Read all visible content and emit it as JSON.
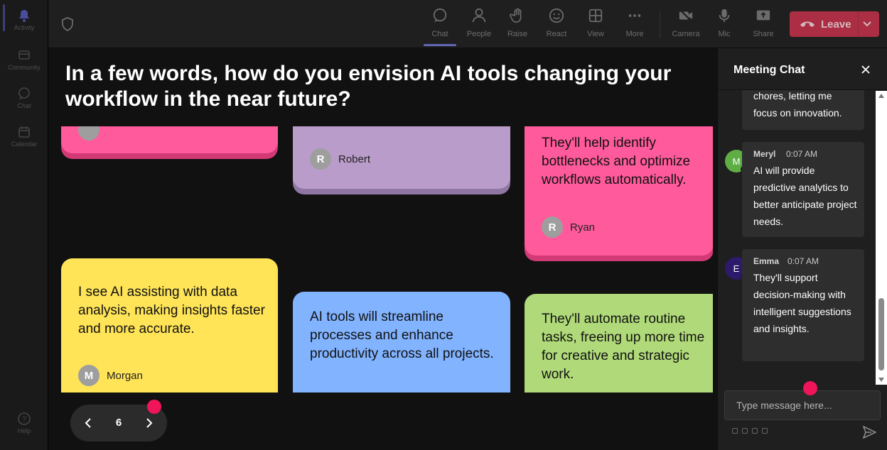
{
  "rail": {
    "items": [
      {
        "label": "Activity",
        "icon": "bell-icon",
        "active": true
      },
      {
        "label": "Community",
        "icon": "community-icon"
      },
      {
        "label": "Chat",
        "icon": "chat-icon"
      },
      {
        "label": "Calendar",
        "icon": "calendar-icon"
      }
    ],
    "help_label": "Help"
  },
  "topbar": {
    "buttons": [
      {
        "label": "Chat",
        "icon": "chat-icon",
        "active": true
      },
      {
        "label": "People",
        "icon": "people-icon"
      },
      {
        "label": "Raise",
        "icon": "raise-hand-icon"
      },
      {
        "label": "React",
        "icon": "smile-icon"
      },
      {
        "label": "View",
        "icon": "grid-view-icon"
      },
      {
        "label": "More",
        "icon": "more-dots-icon"
      },
      {
        "label": "Camera",
        "icon": "camera-off-icon"
      },
      {
        "label": "Mic",
        "icon": "mic-icon"
      },
      {
        "label": "Share",
        "icon": "share-icon"
      }
    ],
    "leave_label": "Leave",
    "leave_color": "#c4314b"
  },
  "question": "In a few words, how do you envision AI tools changing your workflow in the near future?",
  "notes": [
    {
      "text": "",
      "author": "",
      "initial": "",
      "color": "#ff5a9b",
      "shadow": "#d23a75"
    },
    {
      "text": "",
      "author": "Robert",
      "initial": "R",
      "color": "#b99cc9",
      "shadow": "#8f76a3"
    },
    {
      "text": "They'll help identify bottlenecks and optimize workflows automatically.",
      "author": "Ryan",
      "initial": "R",
      "color": "#ff5a9b",
      "shadow": "#d23a75"
    },
    {
      "text": "I see AI assisting with data analysis, making insights faster and more accurate.",
      "author": "Morgan",
      "initial": "M",
      "color": "#ffe457"
    },
    {
      "text": "AI tools will streamline processes and enhance productivity across all projects.",
      "author": "",
      "initial": "",
      "color": "#82b3ff"
    },
    {
      "text": "They'll automate routine tasks, freeing up more time for creative and strategic work.",
      "author": "",
      "initial": "",
      "color": "#b0da79"
    }
  ],
  "pager": {
    "page": "6"
  },
  "chat": {
    "title": "Meeting Chat",
    "messages": [
      {
        "text": "chores, letting me focus on innovation.",
        "name": "",
        "time": "",
        "initial": ""
      },
      {
        "text": "AI will provide predictive analytics to better anticipate project needs.",
        "name": "Meryl",
        "time": "0:07 AM",
        "initial": "M",
        "avatar_color": "#5fae45"
      },
      {
        "text": "They'll support decision-making with intelligent suggestions and insights.",
        "name": "Emma",
        "time": "0:07 AM",
        "initial": "E",
        "avatar_color": "#2e1a6b"
      }
    ],
    "compose_placeholder": "Type message here..."
  },
  "colors": {
    "accent": "#7f85f5",
    "notification_dot": "#f0145a"
  }
}
